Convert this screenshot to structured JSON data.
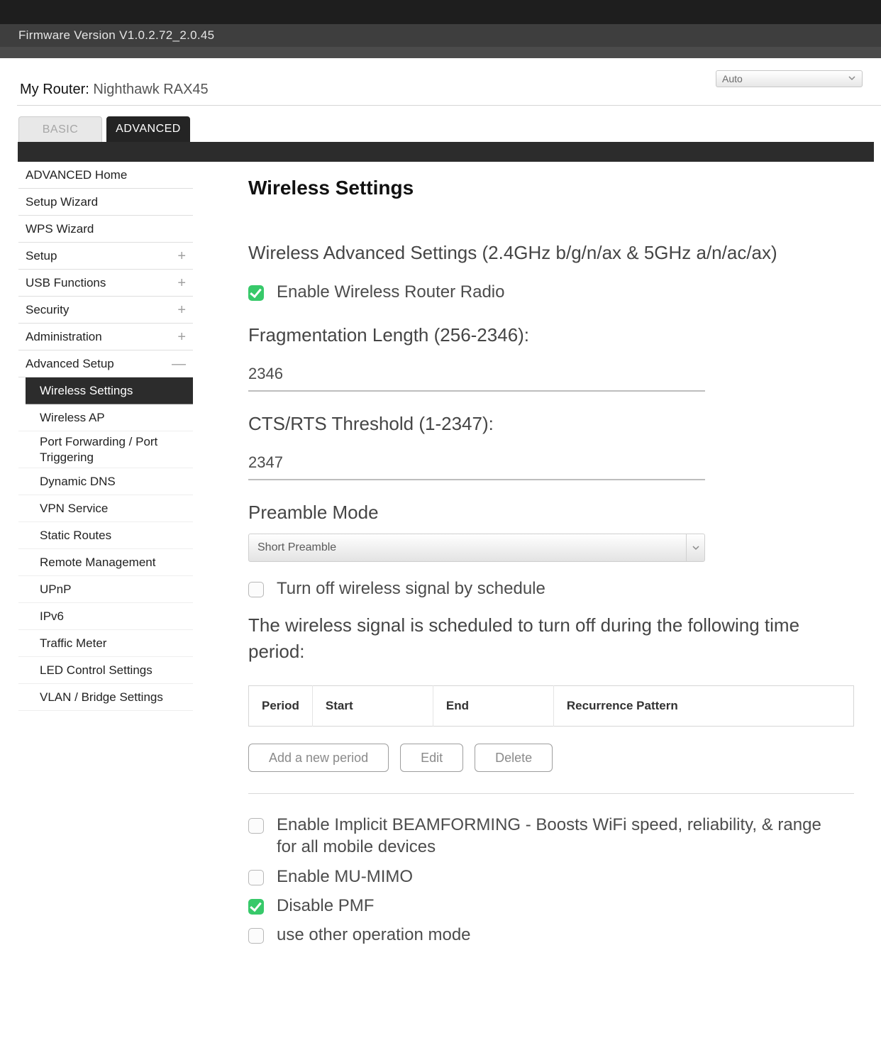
{
  "firmware_line": "Firmware Version V1.0.2.72_2.0.45",
  "header": {
    "my_router_label": "My Router:",
    "model": " Nighthawk RAX45",
    "auto_label": "Auto"
  },
  "tabs": {
    "basic": "BASIC",
    "advanced": "ADVANCED"
  },
  "sidebar": {
    "advanced_home": "ADVANCED Home",
    "setup_wizard": "Setup Wizard",
    "wps_wizard": "WPS Wizard",
    "setup": "Setup",
    "usb_functions": "USB Functions",
    "security": "Security",
    "administration": "Administration",
    "advanced_setup": "Advanced Setup",
    "sub": {
      "wireless_settings": "Wireless Settings",
      "wireless_ap": "Wireless AP",
      "port_forwarding": "Port Forwarding / Port Triggering",
      "dynamic_dns": "Dynamic DNS",
      "vpn_service": "VPN Service",
      "static_routes": "Static Routes",
      "remote_management": "Remote Management",
      "upnp": "UPnP",
      "ipv6": "IPv6",
      "traffic_meter": "Traffic Meter",
      "led_control": "LED Control Settings",
      "vlan_bridge": "VLAN / Bridge Settings"
    }
  },
  "main": {
    "page_title": "Wireless Settings",
    "section_header": "Wireless Advanced Settings (2.4GHz b/g/n/ax & 5GHz a/n/ac/ax)",
    "enable_radio": "Enable Wireless Router Radio",
    "frag_label": "Fragmentation Length (256-2346):",
    "frag_value": "2346",
    "cts_label": "CTS/RTS Threshold (1-2347):",
    "cts_value": "2347",
    "preamble_label": "Preamble Mode",
    "preamble_value": "Short Preamble",
    "sched_cbx": "Turn off wireless signal by schedule",
    "sched_text": "The wireless signal is scheduled to turn off during the following time period:",
    "table": {
      "period": "Period",
      "start": "Start",
      "end": "End",
      "recurrence": "Recurrence Pattern"
    },
    "buttons": {
      "add": "Add a new period",
      "edit": "Edit",
      "delete": "Delete"
    },
    "beamforming": "Enable Implicit BEAMFORMING - Boosts WiFi speed, reliability, & range for all mobile devices",
    "mumimo": "Enable MU-MIMO",
    "pmf": "Disable PMF",
    "opmode": "use other operation mode"
  }
}
